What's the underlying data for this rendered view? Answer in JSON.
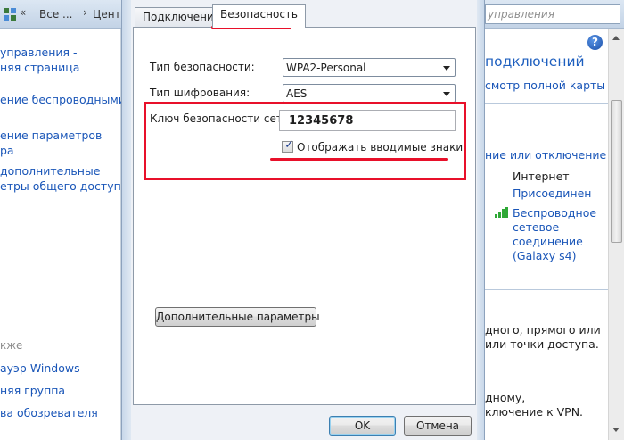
{
  "left_window": {
    "address": {
      "chevron1": "«",
      "part1": "Все ...",
      "chevron2": "›",
      "part2": "Центр"
    },
    "links": [
      "управления -",
      "няя страница",
      "ение беспроводными",
      "ение параметров",
      "ра",
      "дополнительные",
      "етры общего доступа"
    ],
    "see_also": "кже",
    "bottom_links": [
      "ауэр Windows",
      "няя группа",
      "ва обозревателя"
    ]
  },
  "dialog": {
    "tabs": [
      {
        "label": "Подключение"
      },
      {
        "label": "Безопасность"
      }
    ],
    "security_type_label": "Тип безопасности:",
    "security_type_value": "WPA2-Personal",
    "encryption_type_label": "Тип шифрования:",
    "encryption_type_value": "AES",
    "key_label": "Ключ безопасности сети",
    "key_value": "12345678",
    "show_chars_label": "Отображать вводимые знаки",
    "show_chars_checked": true,
    "advanced_button": "Дополнительные параметры",
    "ok_button": "OK",
    "cancel_button": "Отмена",
    "highlight_color": "#e8102a"
  },
  "right_window": {
    "search_placeholder": "управления",
    "help_icon": "?",
    "title": "подключений",
    "map_link": "смотр полной карты",
    "toggle_link": "ние или отключение",
    "internet_label": "Интернет",
    "connected_link": "Присоединен",
    "wireless_link_lines": [
      "Беспроводное",
      "сетевое",
      "соединение",
      "(Galaxy s4)"
    ],
    "text_lines_1": [
      "дного, прямого или",
      "или точки доступа."
    ],
    "text_lines_2": [
      "дному,",
      "ключение к VPN."
    ]
  }
}
